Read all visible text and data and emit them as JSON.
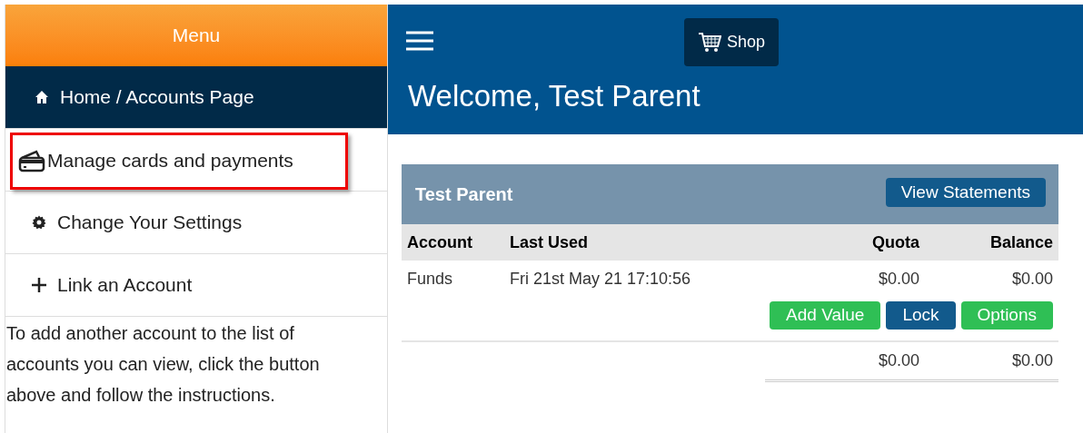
{
  "sidebar": {
    "title": "Menu",
    "items": [
      {
        "label": "Home / Accounts Page",
        "kind": "home",
        "selected": true,
        "highlighted": false
      },
      {
        "label": "Manage cards and payments",
        "kind": "card",
        "selected": false,
        "highlighted": true
      },
      {
        "label": "Change Your Settings",
        "kind": "settings",
        "selected": false,
        "highlighted": false
      },
      {
        "label": "Link an Account",
        "kind": "add",
        "selected": false,
        "highlighted": false
      }
    ],
    "help_text": "To add another account to the list of accounts you can view, click the button above and follow the instructions."
  },
  "header": {
    "shop_button": "Shop",
    "welcome": "Welcome, Test Parent"
  },
  "card": {
    "title": "Test Parent",
    "action": "View Statements",
    "table": {
      "columns": [
        "Account",
        "Last Used",
        "Quota",
        "Balance"
      ],
      "rows": [
        {
          "account": "Funds",
          "last_used": "Fri 21st May 21 17:10:56",
          "quota": "$0.00",
          "balance": "$0.00",
          "actions": [
            {
              "label": "Add Value",
              "kind": "success"
            },
            {
              "label": "Lock",
              "kind": "primary"
            },
            {
              "label": "Options",
              "kind": "success"
            }
          ]
        }
      ],
      "totals": {
        "quota": "$0.00",
        "balance": "$0.00"
      }
    }
  }
}
